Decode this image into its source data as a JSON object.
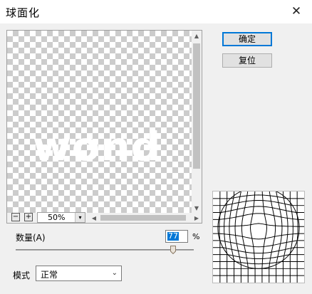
{
  "window": {
    "title": "球面化",
    "close_glyph": "✕"
  },
  "preview": {
    "word": "wond",
    "zoom_out_glyph": "−",
    "zoom_in_glyph": "+",
    "zoom_level": "50%",
    "dropdown_glyph": "▾",
    "scroll_up_glyph": "▲",
    "scroll_down_glyph": "▼",
    "scroll_left_glyph": "◀",
    "scroll_right_glyph": "▶"
  },
  "buttons": {
    "ok_label": "确定",
    "reset_label": "复位"
  },
  "amount": {
    "label": "数量(A)",
    "value": "77",
    "unit": "%",
    "slider_fraction": 0.885
  },
  "mode": {
    "label": "模式",
    "selected": "正常",
    "dropdown_glyph": "⌄"
  },
  "colors": {
    "accent": "#0078d7"
  }
}
